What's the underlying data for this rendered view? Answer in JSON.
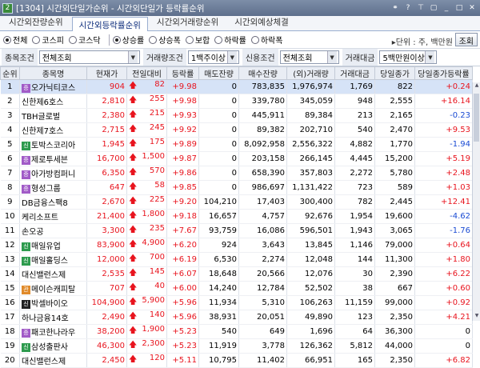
{
  "window": {
    "screen_no": "2",
    "title": "[1304]  시간외단일가순위 - 시간외단일가 등락률순위"
  },
  "tabs": [
    {
      "label": "시간외잔량순위",
      "active": false
    },
    {
      "label": "시간외등락률순위",
      "active": true
    },
    {
      "label": "시간외거래량순위",
      "active": false
    },
    {
      "label": "시간외예상체결",
      "active": false
    }
  ],
  "market": [
    "전체",
    "코스피",
    "코스닥"
  ],
  "trend": [
    "상승률",
    "상승폭",
    "보합",
    "하락률",
    "하락폭"
  ],
  "unit_label": "▸단위 : 주, 백만원",
  "inquiry_button": "조회",
  "conditions": {
    "stock_label": "종목조건",
    "stock_value": "전체조회",
    "volume_label": "거래량조건",
    "volume_value": "1백주이상",
    "credit_label": "신용조건",
    "credit_value": "전체조회",
    "amount_label": "거래대금",
    "amount_value": "5백만원이상"
  },
  "columns": [
    "순위",
    "종목명",
    "현재가",
    "전일대비",
    "등락률",
    "매도잔량",
    "매수잔량",
    "(외)거래량",
    "거래대금",
    "당일종가",
    "당일종가등락률"
  ],
  "rows": [
    {
      "rank": "1",
      "badge": "증",
      "badge_color": "purple",
      "name": "오가닉티코스",
      "price": "904",
      "chg": "82",
      "pct": "+9.98",
      "ask": "0",
      "bid": "783,835",
      "vol": "1,976,974",
      "amt": "1,769",
      "close": "822",
      "close_pct": "+0.24",
      "close_dir": "up"
    },
    {
      "rank": "2",
      "badge": "",
      "badge_color": "",
      "name": "신한제6호스",
      "price": "2,810",
      "chg": "255",
      "pct": "+9.98",
      "ask": "0",
      "bid": "339,780",
      "vol": "345,059",
      "amt": "948",
      "close": "2,555",
      "close_pct": "+16.14",
      "close_dir": "up"
    },
    {
      "rank": "3",
      "badge": "",
      "badge_color": "",
      "name": "TBH글로벌",
      "price": "2,380",
      "chg": "215",
      "pct": "+9.93",
      "ask": "0",
      "bid": "445,911",
      "vol": "89,384",
      "amt": "213",
      "close": "2,165",
      "close_pct": "-0.23",
      "close_dir": "down"
    },
    {
      "rank": "4",
      "badge": "",
      "badge_color": "",
      "name": "신한제7호스",
      "price": "2,715",
      "chg": "245",
      "pct": "+9.92",
      "ask": "0",
      "bid": "89,382",
      "vol": "202,710",
      "amt": "540",
      "close": "2,470",
      "close_pct": "+9.53",
      "close_dir": "up"
    },
    {
      "rank": "5",
      "badge": "신",
      "badge_color": "green",
      "name": "토박스코리아",
      "price": "1,945",
      "chg": "175",
      "pct": "+9.89",
      "ask": "0",
      "bid": "8,092,958",
      "vol": "2,556,322",
      "amt": "4,882",
      "close": "1,770",
      "close_pct": "-1.94",
      "close_dir": "down"
    },
    {
      "rank": "6",
      "badge": "증",
      "badge_color": "purple",
      "name": "제로투세븐",
      "price": "16,700",
      "chg": "1,500",
      "pct": "+9.87",
      "ask": "0",
      "bid": "203,158",
      "vol": "266,145",
      "amt": "4,445",
      "close": "15,200",
      "close_pct": "+5.19",
      "close_dir": "up"
    },
    {
      "rank": "7",
      "badge": "증",
      "badge_color": "purple",
      "name": "아가방컴퍼니",
      "price": "6,350",
      "chg": "570",
      "pct": "+9.86",
      "ask": "0",
      "bid": "658,390",
      "vol": "357,803",
      "amt": "2,272",
      "close": "5,780",
      "close_pct": "+2.48",
      "close_dir": "up"
    },
    {
      "rank": "8",
      "badge": "증",
      "badge_color": "purple",
      "name": "형성그룹",
      "price": "647",
      "chg": "58",
      "pct": "+9.85",
      "ask": "0",
      "bid": "986,697",
      "vol": "1,131,422",
      "amt": "723",
      "close": "589",
      "close_pct": "+1.03",
      "close_dir": "up"
    },
    {
      "rank": "9",
      "badge": "",
      "badge_color": "",
      "name": "DB금융스팩8",
      "price": "2,670",
      "chg": "225",
      "pct": "+9.20",
      "ask": "104,210",
      "bid": "17,403",
      "vol": "300,400",
      "amt": "782",
      "close": "2,445",
      "close_pct": "+12.41",
      "close_dir": "up"
    },
    {
      "rank": "10",
      "badge": "",
      "badge_color": "",
      "name": "케리소프트",
      "price": "21,400",
      "chg": "1,800",
      "pct": "+9.18",
      "ask": "16,657",
      "bid": "4,757",
      "vol": "92,676",
      "amt": "1,954",
      "close": "19,600",
      "close_pct": "-4.62",
      "close_dir": "down"
    },
    {
      "rank": "11",
      "badge": "",
      "badge_color": "",
      "name": "손오공",
      "price": "3,300",
      "chg": "235",
      "pct": "+7.67",
      "ask": "93,759",
      "bid": "16,086",
      "vol": "596,501",
      "amt": "1,943",
      "close": "3,065",
      "close_pct": "-1.76",
      "close_dir": "down"
    },
    {
      "rank": "12",
      "badge": "신",
      "badge_color": "green",
      "name": "매일유업",
      "price": "83,900",
      "chg": "4,900",
      "pct": "+6.20",
      "ask": "924",
      "bid": "3,643",
      "vol": "13,845",
      "amt": "1,146",
      "close": "79,000",
      "close_pct": "+0.64",
      "close_dir": "up"
    },
    {
      "rank": "13",
      "badge": "신",
      "badge_color": "green",
      "name": "매일홀딩스",
      "price": "12,000",
      "chg": "700",
      "pct": "+6.19",
      "ask": "6,530",
      "bid": "2,274",
      "vol": "12,048",
      "amt": "144",
      "close": "11,300",
      "close_pct": "+1.80",
      "close_dir": "up"
    },
    {
      "rank": "14",
      "badge": "",
      "badge_color": "",
      "name": "대신밸런스제",
      "price": "2,535",
      "chg": "145",
      "pct": "+6.07",
      "ask": "18,648",
      "bid": "20,566",
      "vol": "12,076",
      "amt": "30",
      "close": "2,390",
      "close_pct": "+6.22",
      "close_dir": "up"
    },
    {
      "rank": "15",
      "badge": "관",
      "badge_color": "orange",
      "name": "메이슨캐피탈",
      "price": "707",
      "chg": "40",
      "pct": "+6.00",
      "ask": "14,240",
      "bid": "12,784",
      "vol": "52,502",
      "amt": "38",
      "close": "667",
      "close_pct": "+0.60",
      "close_dir": "up"
    },
    {
      "rank": "16",
      "badge": "신",
      "badge_color": "black",
      "name": "박셀바이오",
      "price": "104,900",
      "chg": "5,900",
      "pct": "+5.96",
      "ask": "11,934",
      "bid": "5,310",
      "vol": "106,263",
      "amt": "11,159",
      "close": "99,000",
      "close_pct": "+0.92",
      "close_dir": "up"
    },
    {
      "rank": "17",
      "badge": "",
      "badge_color": "",
      "name": "하나금융14호",
      "price": "2,490",
      "chg": "140",
      "pct": "+5.96",
      "ask": "38,931",
      "bid": "20,051",
      "vol": "49,890",
      "amt": "123",
      "close": "2,350",
      "close_pct": "+4.21",
      "close_dir": "up"
    },
    {
      "rank": "18",
      "badge": "증",
      "badge_color": "purple",
      "name": "패코한나라우",
      "price": "38,200",
      "chg": "1,900",
      "pct": "+5.23",
      "ask": "540",
      "bid": "649",
      "vol": "1,696",
      "amt": "64",
      "close": "36,300",
      "close_pct": "0",
      "close_dir": "none"
    },
    {
      "rank": "19",
      "badge": "신",
      "badge_color": "green",
      "name": "삼성출판사",
      "price": "46,300",
      "chg": "2,300",
      "pct": "+5.23",
      "ask": "11,919",
      "bid": "3,778",
      "vol": "126,362",
      "amt": "5,812",
      "close": "44,000",
      "close_pct": "0",
      "close_dir": "none"
    },
    {
      "rank": "20",
      "badge": "",
      "badge_color": "",
      "name": "대신밸런스제",
      "price": "2,450",
      "chg": "120",
      "pct": "+5.11",
      "ask": "10,795",
      "bid": "11,402",
      "vol": "66,951",
      "amt": "165",
      "close": "2,350",
      "close_pct": "+6.82",
      "close_dir": "up"
    }
  ]
}
